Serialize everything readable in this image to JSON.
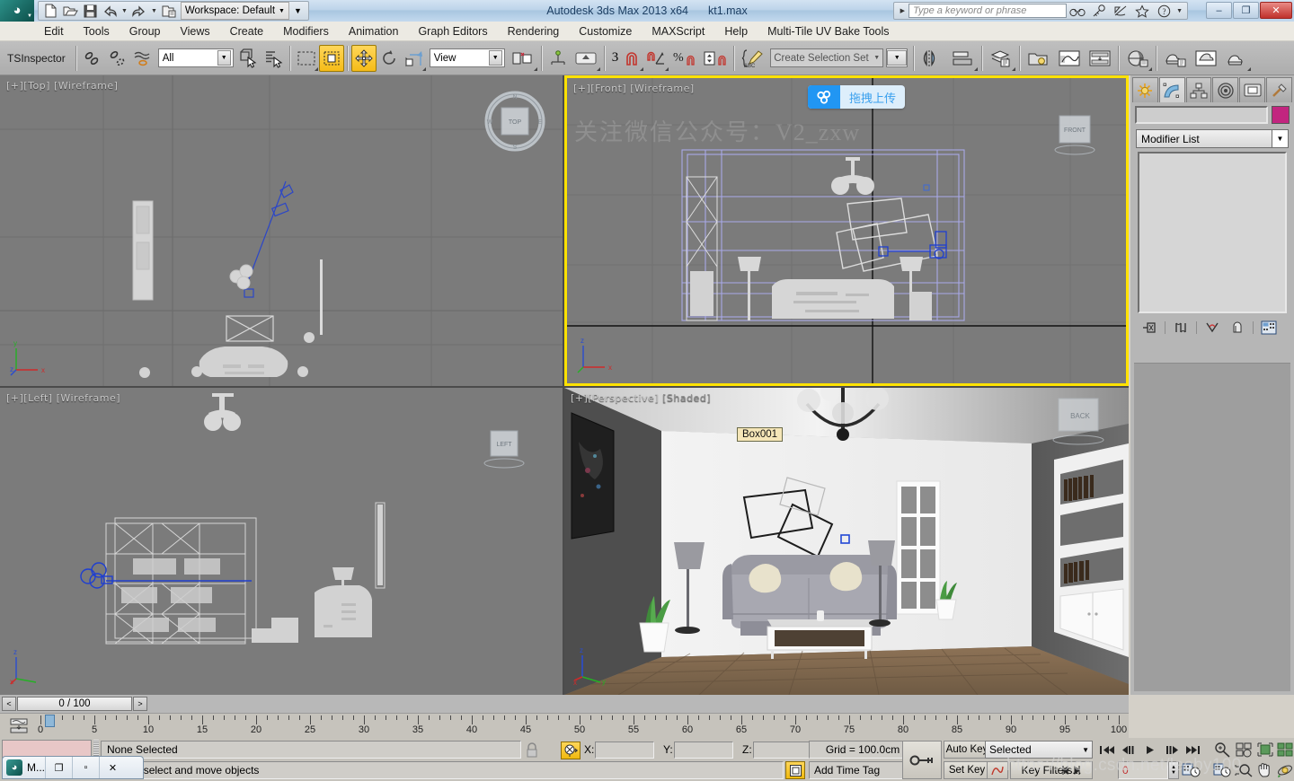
{
  "titlebar": {
    "app_title": "Autodesk 3ds Max  2013 x64",
    "file_name": "kt1.max",
    "workspace_label": "Workspace: Default",
    "search_placeholder": "Type a keyword or phrase",
    "quick_access": [
      {
        "name": "new-icon",
        "label": "New"
      },
      {
        "name": "open-icon",
        "label": "Open"
      },
      {
        "name": "save-icon",
        "label": "Save"
      },
      {
        "name": "undo-icon",
        "label": "Undo"
      },
      {
        "name": "redo-icon",
        "label": "Redo"
      },
      {
        "name": "project-folder-icon",
        "label": "Set Project Folder"
      }
    ],
    "help_icons": [
      {
        "name": "binoculars-icon",
        "label": "Search"
      },
      {
        "name": "key-icon",
        "label": "Keyboard Shortcut"
      },
      {
        "name": "satellite-icon",
        "label": "Autodesk Exchange"
      },
      {
        "name": "star-icon",
        "label": "Favorites"
      },
      {
        "name": "help-icon",
        "label": "Help"
      }
    ],
    "window_controls": {
      "minimize": "–",
      "maximize": "❐",
      "close": "✕"
    }
  },
  "menubar": {
    "items": [
      "Edit",
      "Tools",
      "Group",
      "Views",
      "Create",
      "Modifiers",
      "Animation",
      "Graph Editors",
      "Rendering",
      "Customize",
      "MAXScript",
      "Help",
      "Multi-Tile UV Bake Tools"
    ]
  },
  "toolbar": {
    "plugin_label": "TSInspector",
    "selection_filter": "All",
    "reference_coord": "View",
    "selection_set_placeholder": "Create Selection Set",
    "snap_count_label": "3",
    "percent_label": "%",
    "buttons": [
      {
        "name": "select-and-link-icon",
        "label": "Select and Link"
      },
      {
        "name": "unlink-selection-icon",
        "label": "Unlink Selection"
      },
      {
        "name": "bind-to-space-warp-icon",
        "label": "Bind to Space Warp"
      },
      {
        "name": "select-object-icon",
        "label": "Select Object"
      },
      {
        "name": "select-by-name-icon",
        "label": "Select by Name"
      },
      {
        "name": "rectangular-selection-region-icon",
        "label": "Rectangular Selection Region"
      },
      {
        "name": "window-crossing-icon",
        "label": "Window / Crossing",
        "active": true
      },
      {
        "name": "select-and-move-icon",
        "label": "Select and Move",
        "active": true
      },
      {
        "name": "select-and-rotate-icon",
        "label": "Select and Rotate"
      },
      {
        "name": "select-and-scale-icon",
        "label": "Select and Uniform Scale"
      },
      {
        "name": "use-center-flyout-icon",
        "label": "Use Pivot Point Center"
      },
      {
        "name": "select-and-manipulate-icon",
        "label": "Select and Manipulate"
      },
      {
        "name": "snaps-toggle-icon",
        "label": "Snaps Toggle"
      },
      {
        "name": "angle-snap-toggle-icon",
        "label": "Angle Snap Toggle"
      },
      {
        "name": "percent-snap-toggle-icon",
        "label": "Percent Snap Toggle"
      },
      {
        "name": "spinner-snap-toggle-icon",
        "label": "Spinner Snap Toggle"
      },
      {
        "name": "edit-named-selection-sets-icon",
        "label": "Edit Named Selection Sets"
      },
      {
        "name": "mirror-icon",
        "label": "Mirror"
      },
      {
        "name": "align-icon",
        "label": "Align"
      },
      {
        "name": "layer-manager-icon",
        "label": "Manage Layers"
      },
      {
        "name": "scene-explorer-icon",
        "label": "Scene Explorer"
      },
      {
        "name": "curve-editor-icon",
        "label": "Curve Editor"
      },
      {
        "name": "schematic-view-icon",
        "label": "Schematic View"
      },
      {
        "name": "material-editor-icon",
        "label": "Material Editor"
      },
      {
        "name": "render-setup-icon",
        "label": "Render Setup"
      },
      {
        "name": "rendered-frame-window-icon",
        "label": "Rendered Frame Window"
      },
      {
        "name": "render-production-icon",
        "label": "Render Production"
      }
    ]
  },
  "viewports": [
    {
      "key": "top",
      "label": "[+] [ Top ] [ Wireframe ]",
      "cube": "TOP",
      "active": false
    },
    {
      "key": "front",
      "label": "[+] [ Front ] [ Wireframe ]",
      "cube": "FRONT",
      "active": true
    },
    {
      "key": "left",
      "label": "[+] [ Left ] [ Wireframe ]",
      "cube": "LEFT",
      "active": false
    },
    {
      "key": "perspective",
      "label": "[+] [ Perspective ] [ Shaded ]",
      "cube": "BACK",
      "active": false
    }
  ],
  "viewport_labels": {
    "top": "[+][Top] [Wireframe]",
    "front": "[+][Front] [Wireframe]",
    "left": "[+][Left] [Wireframe]",
    "perspective_active": "[+][Perspective]",
    "perspective_dim": " [Shaded]"
  },
  "overlay": {
    "upload_badge_text": "拖拽上传",
    "watermark_cn": "关注微信公众号：",
    "watermark_latin": "V2_zxw",
    "watermark_url": "https://blog.csdn.net/leeby100"
  },
  "scene": {
    "selected_object_label": "Box001",
    "axis_labels": {
      "x": "x",
      "y": "y",
      "z": "z"
    }
  },
  "command_panel": {
    "tabs": [
      {
        "name": "create-tab",
        "label": "Create",
        "selected": false
      },
      {
        "name": "modify-tab",
        "label": "Modify",
        "selected": true
      },
      {
        "name": "hierarchy-tab",
        "label": "Hierarchy",
        "selected": false
      },
      {
        "name": "motion-tab",
        "label": "Motion",
        "selected": false
      },
      {
        "name": "display-tab",
        "label": "Display",
        "selected": false
      },
      {
        "name": "utilities-tab",
        "label": "Utilities",
        "selected": false
      }
    ],
    "object_name_value": "",
    "object_color": "#c2257f",
    "modifier_list_label": "Modifier List",
    "stack_tools": [
      {
        "name": "pin-stack-icon",
        "label": "Pin Stack"
      },
      {
        "name": "show-end-result-icon",
        "label": "Show end result"
      },
      {
        "name": "make-unique-icon",
        "label": "Make unique"
      },
      {
        "name": "remove-modifier-icon",
        "label": "Remove modifier"
      },
      {
        "name": "configure-modifier-sets-icon",
        "label": "Configure Modifier Sets"
      }
    ]
  },
  "timeline": {
    "frame_readout": "0 / 100",
    "prev_frame_symbol": "<",
    "next_frame_symbol": ">",
    "ruler_min": 0,
    "ruler_max": 100,
    "ruler_step": 5,
    "ruler_labels": [
      "0",
      "5",
      "10",
      "15",
      "20",
      "25",
      "30",
      "35",
      "40",
      "45",
      "50",
      "55",
      "60",
      "65",
      "70",
      "75",
      "80",
      "85",
      "90",
      "95",
      "100"
    ],
    "current_frame": 0
  },
  "statusbar": {
    "selection_text": "None Selected",
    "prompt_text": "drag to select and move objects",
    "coord_x_label": "X:",
    "coord_y_label": "Y:",
    "coord_z_label": "Z:",
    "coord_x_value": "",
    "coord_y_value": "",
    "coord_z_value": "",
    "grid_text": "Grid = 100.0cm",
    "add_time_tag": "Add Time Tag",
    "auto_key": "Auto Key",
    "set_key": "Set Key",
    "key_mode_selection": "Selected",
    "key_filters": "Key Filters...",
    "frame_value": "0",
    "icons": [
      {
        "name": "lock-selection-icon",
        "label": "Selection Lock Toggle"
      },
      {
        "name": "absolute-relative-transform-icon",
        "label": "Absolute / Relative Transform Toggle"
      },
      {
        "name": "key-mode-toggle-icon",
        "label": "Key Mode Toggle"
      },
      {
        "name": "time-configuration-icon",
        "label": "Time Configuration"
      },
      {
        "name": "zoom-icon",
        "label": "Zoom"
      },
      {
        "name": "zoom-all-icon",
        "label": "Zoom All"
      },
      {
        "name": "zoom-extents-icon",
        "label": "Zoom Extents"
      },
      {
        "name": "zoom-region-icon",
        "label": "Zoom Region"
      },
      {
        "name": "pan-icon",
        "label": "Pan View"
      },
      {
        "name": "orbit-icon",
        "label": "Orbit"
      },
      {
        "name": "maximize-viewport-icon",
        "label": "Maximize Viewport Toggle"
      },
      {
        "name": "field-of-view-icon",
        "label": "Field of View"
      }
    ],
    "playback": [
      {
        "name": "go-to-start-icon",
        "label": "Go to Start"
      },
      {
        "name": "previous-frame-icon",
        "label": "Previous Frame"
      },
      {
        "name": "play-animation-icon",
        "label": "Play Animation"
      },
      {
        "name": "next-frame-icon",
        "label": "Next Frame"
      },
      {
        "name": "go-to-end-icon",
        "label": "Go to End"
      }
    ]
  },
  "taskbar": {
    "min_window_title": "M...",
    "buttons": [
      {
        "name": "restore-icon",
        "label": "Restore"
      },
      {
        "name": "minimize-icon",
        "label": "Minimize"
      },
      {
        "name": "close-icon",
        "label": "Close"
      }
    ]
  }
}
